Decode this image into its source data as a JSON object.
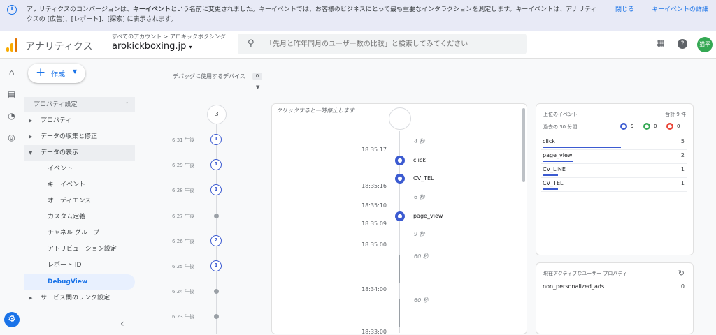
{
  "banner": {
    "text_a": "アナリティクスのコンバージョンは、",
    "text_bold": "キーイベント",
    "text_b": "という名前に変更されました。キーイベントでは、お客様のビジネスにとって最も重要なインタラクションを測定します。キーイベントは、アナリティクスの [広告]、[レポート]、[探索] に表示されます。",
    "close_label": "閉じる",
    "details_label": "キーイベントの詳細"
  },
  "header": {
    "app_name": "アナリティクス",
    "breadcrumb": "すべてのアカウント > アロキックボクシング…",
    "property": "arokickboxing.jp",
    "search_placeholder": "「先月と昨年同月のユーザー数の比較」と検索してみてください",
    "avatar_text": "猫平"
  },
  "nav": {
    "create_label": "作成",
    "section_header": "プロパティ設定",
    "items": [
      {
        "label": "プロパティ"
      },
      {
        "label": "データの収集と修正"
      },
      {
        "label": "データの表示"
      }
    ],
    "sub_items": [
      {
        "label": "イベント"
      },
      {
        "label": "キーイベント"
      },
      {
        "label": "オーディエンス"
      },
      {
        "label": "カスタム定義"
      },
      {
        "label": "チャネル グループ"
      },
      {
        "label": "アトリビューション設定"
      },
      {
        "label": "レポート ID"
      },
      {
        "label": "DebugView"
      }
    ],
    "last_item": "サービス間のリンク設定"
  },
  "debug": {
    "device_label": "デバッグに使用するデバイス",
    "device_count": "0"
  },
  "timeline": {
    "top_count": "3",
    "entries": [
      {
        "time": "6:31 午後",
        "count": "1"
      },
      {
        "time": "6:29 午後",
        "count": "1"
      },
      {
        "time": "6:28 午後",
        "count": "1"
      },
      {
        "time": "6:27 午後",
        "count": ""
      },
      {
        "time": "6:26 午後",
        "count": "2"
      },
      {
        "time": "6:25 午後",
        "count": "1"
      },
      {
        "time": "6:24 午後",
        "count": ""
      },
      {
        "time": "6:23 午後",
        "count": ""
      }
    ]
  },
  "stream": {
    "hint": "クリックすると一時停止します",
    "gaps": [
      "4 秒",
      "6 秒",
      "9 秒",
      "60 秒",
      "60 秒"
    ],
    "times": [
      "18:35:17",
      "18:35:16",
      "18:35:10",
      "18:35:09",
      "18:35:00",
      "18:34:00",
      "18:33:00"
    ],
    "events": [
      {
        "name": "click"
      },
      {
        "name": "CV_TEL"
      },
      {
        "name": "page_view"
      }
    ]
  },
  "top_events": {
    "title": "上位のイベント",
    "total": "合計 9 件",
    "period": "過去の 30 分間",
    "counts": {
      "blue": "9",
      "green": "0",
      "orange": "0"
    },
    "rows": [
      {
        "name": "click",
        "value": "5",
        "share": 0.56
      },
      {
        "name": "page_view",
        "value": "2",
        "share": 0.22
      },
      {
        "name": "CV_LINE",
        "value": "1",
        "share": 0.11
      },
      {
        "name": "CV_TEL",
        "value": "1",
        "share": 0.11
      }
    ]
  },
  "user_props": {
    "title": "現在アクティブなユーザー プロパティ",
    "rows": [
      {
        "name": "non_personalized_ads",
        "value": "0"
      }
    ]
  }
}
